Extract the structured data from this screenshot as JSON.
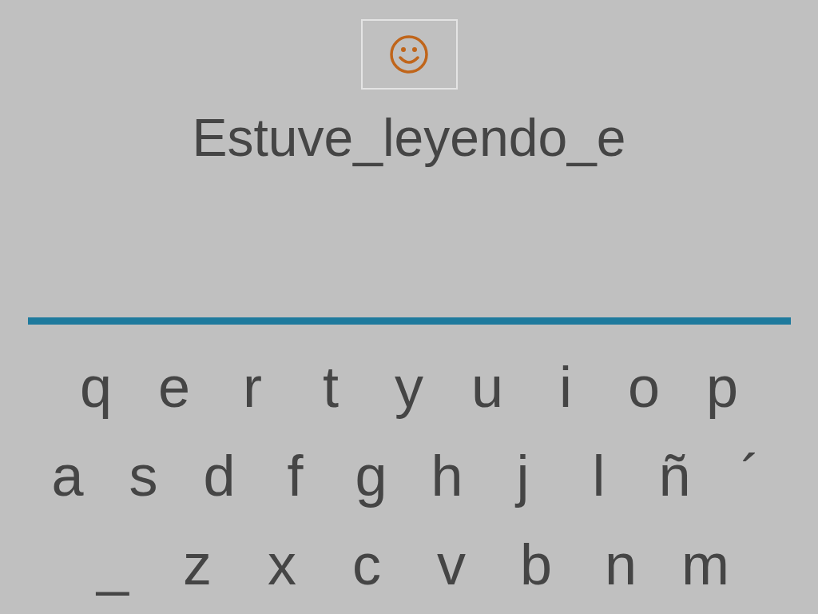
{
  "prompt": {
    "text": "Estuve_leyendo_e"
  },
  "keyboard": {
    "rows": [
      {
        "keys": [
          "q",
          "e",
          "r",
          "t",
          "y",
          "u",
          "i",
          "o",
          "p"
        ]
      },
      {
        "keys": [
          "a",
          "s",
          "d",
          "f",
          "g",
          "h",
          "j",
          "l",
          "ñ",
          "´"
        ]
      },
      {
        "keys": [
          "_",
          "z",
          "x",
          "c",
          "v",
          "b",
          "n",
          "m"
        ]
      }
    ]
  }
}
